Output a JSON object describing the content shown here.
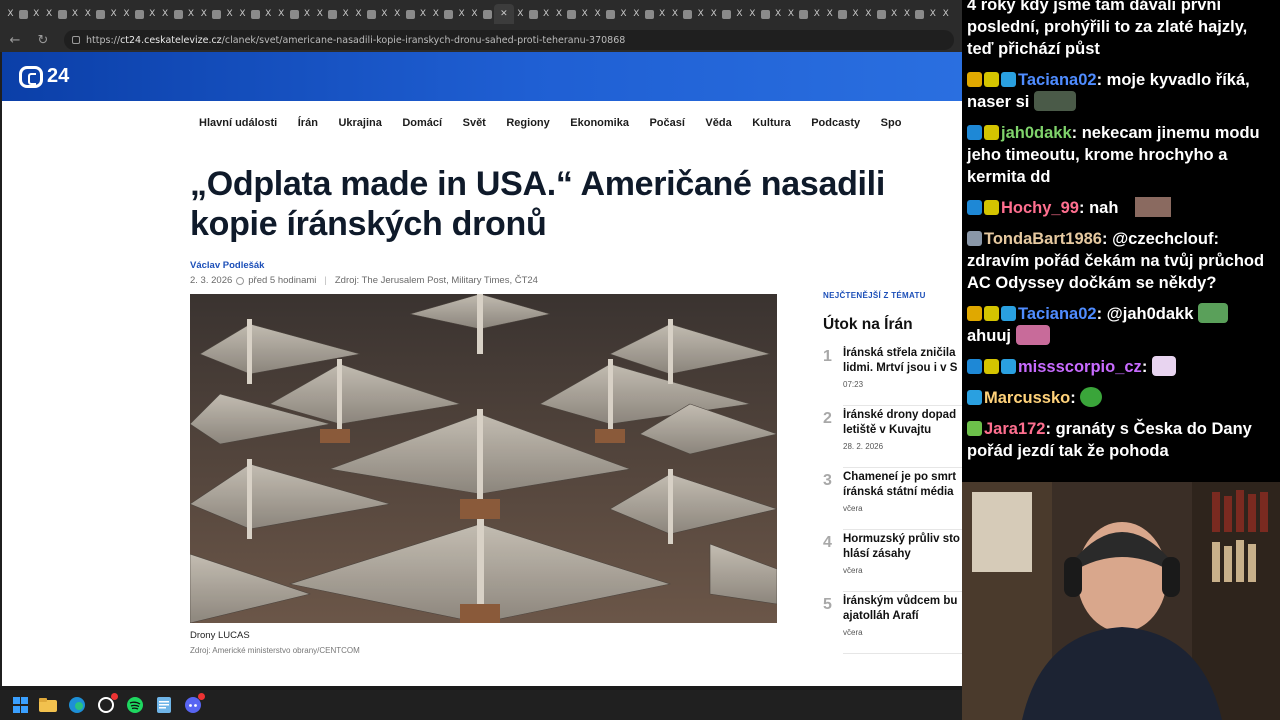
{
  "browser": {
    "tabs": [
      "X",
      "X",
      "X",
      "X",
      "X",
      "X",
      "X",
      "X",
      "X",
      "X",
      "X",
      "X",
      "X",
      "X",
      "X",
      "X",
      "X",
      "X",
      "X",
      "X",
      "X",
      "X",
      "X",
      "X",
      "X",
      "X",
      "X",
      "X",
      "X",
      "X",
      "X",
      "X",
      "X",
      "X",
      "X",
      "X",
      "X",
      "X",
      "X",
      "X",
      "X",
      "X",
      "X",
      "X",
      "X",
      "X",
      "X",
      "X",
      "X",
      "X",
      "X",
      "X",
      "X",
      "X",
      "X",
      "X",
      "X",
      "X",
      "X",
      "X",
      "X",
      "X",
      "X",
      "X",
      "X",
      "X",
      "X",
      "X",
      "X",
      "X",
      "X",
      "X",
      "X"
    ],
    "active_tab_close": "✕",
    "nav_back": "←",
    "nav_reload": "↻",
    "url_prefix": "https://",
    "url_domain": "ct24.ceskatelevize.cz",
    "url_path": "/clanek/svet/americane-nasadili-kopie-iranskych-dronu-sahed-proti-teheranu-370868"
  },
  "site": {
    "logo_text": "24",
    "nav": [
      "Hlavní události",
      "Írán",
      "Ukrajina",
      "Domácí",
      "Svět",
      "Regiony",
      "Ekonomika",
      "Počasí",
      "Věda",
      "Kultura",
      "Podcasty",
      "Spo"
    ]
  },
  "article": {
    "title": "„Odplata made in USA.“ Američané nasadili kopie íránských dronů",
    "author": "Václav Podlešák",
    "date": "2. 3. 2026",
    "ago": "před 5 hodinami",
    "source": "Zdroj: The Jerusalem Post, Military Times, ČT24",
    "caption": "Drony LUCAS",
    "credit": "Zdroj: Americké ministerstvo obrany/CENTCOM"
  },
  "sidebar": {
    "label": "NEJČTENĚJŠÍ Z TÉMATU",
    "title": "Útok na Írán",
    "items": [
      {
        "num": "1",
        "line1": "Íránská střela zničila",
        "line2": "lidmi. Mrtví jsou i v S",
        "time": "07:23"
      },
      {
        "num": "2",
        "line1": "Íránské drony dopad",
        "line2": "letiště v Kuvajtu",
        "time": "28. 2. 2026"
      },
      {
        "num": "3",
        "line1": "Chameneí je po smrt",
        "line2": "íránská státní média",
        "time": "včera"
      },
      {
        "num": "4",
        "line1": "Hormuzský průliv sto",
        "line2": "hlásí zásahy",
        "time": "včera"
      },
      {
        "num": "5",
        "line1": "Íránským vůdcem bu",
        "line2": "ajatolláh Arafí",
        "time": "včera"
      }
    ]
  },
  "chat": {
    "top_text": "4 roky kdy jsme tam dávali první poslední, prohýřili to za zlaté hajzly, teď přichází půst",
    "messages": [
      {
        "user": "Taciana02",
        "color": "#4f8cff",
        "text": "moje kyvadlo říká, naser si",
        "badges": [
          "#e0a800",
          "#d4c400",
          "#2aa0e0"
        ]
      },
      {
        "user": "jah0dakk",
        "color": "#7fd36b",
        "text": "nekecam jinemu modu jeho timeoutu, krome hrochyho a kermita dd",
        "badges": [
          "#1e88d6",
          "#d4c400"
        ]
      },
      {
        "user": "Hochy_99",
        "color": "#ff6f8f",
        "text": "nah",
        "badges": [
          "#1e88d6",
          "#d4c400"
        ]
      },
      {
        "user": "TondaBart1986",
        "color": "#e6c9a0",
        "text": "@czechclouf: zdravím pořád čekám na tvůj průchod AC Odyssey dočkám se někdy?",
        "badges": [
          "#8a97a8"
        ]
      },
      {
        "user": "Taciana02",
        "color": "#4f8cff",
        "text": "@jah0dakk",
        "text2": "ahuuj",
        "badges": [
          "#e0a800",
          "#d4c400",
          "#2aa0e0"
        ]
      },
      {
        "user": "missscorpio_cz",
        "color": "#c86bff",
        "text": "",
        "badges": [
          "#1e88d6",
          "#d4c400",
          "#2aa0e0"
        ]
      },
      {
        "user": "Marcussko",
        "color": "#ffd27a",
        "text": "",
        "badges": [
          "#2aa0e0"
        ]
      },
      {
        "user": "Jara172",
        "color": "#ff6f8f",
        "text": "granáty s Česka do Dany pořád jezdí tak že pohoda",
        "badges": [
          "#6cc04a"
        ]
      }
    ]
  },
  "taskbar": {
    "icons": [
      "windows-icon",
      "file-explorer-icon",
      "edge-icon",
      "chatgpt-icon",
      "spotify-icon",
      "notepad-icon",
      "discord-icon"
    ]
  }
}
